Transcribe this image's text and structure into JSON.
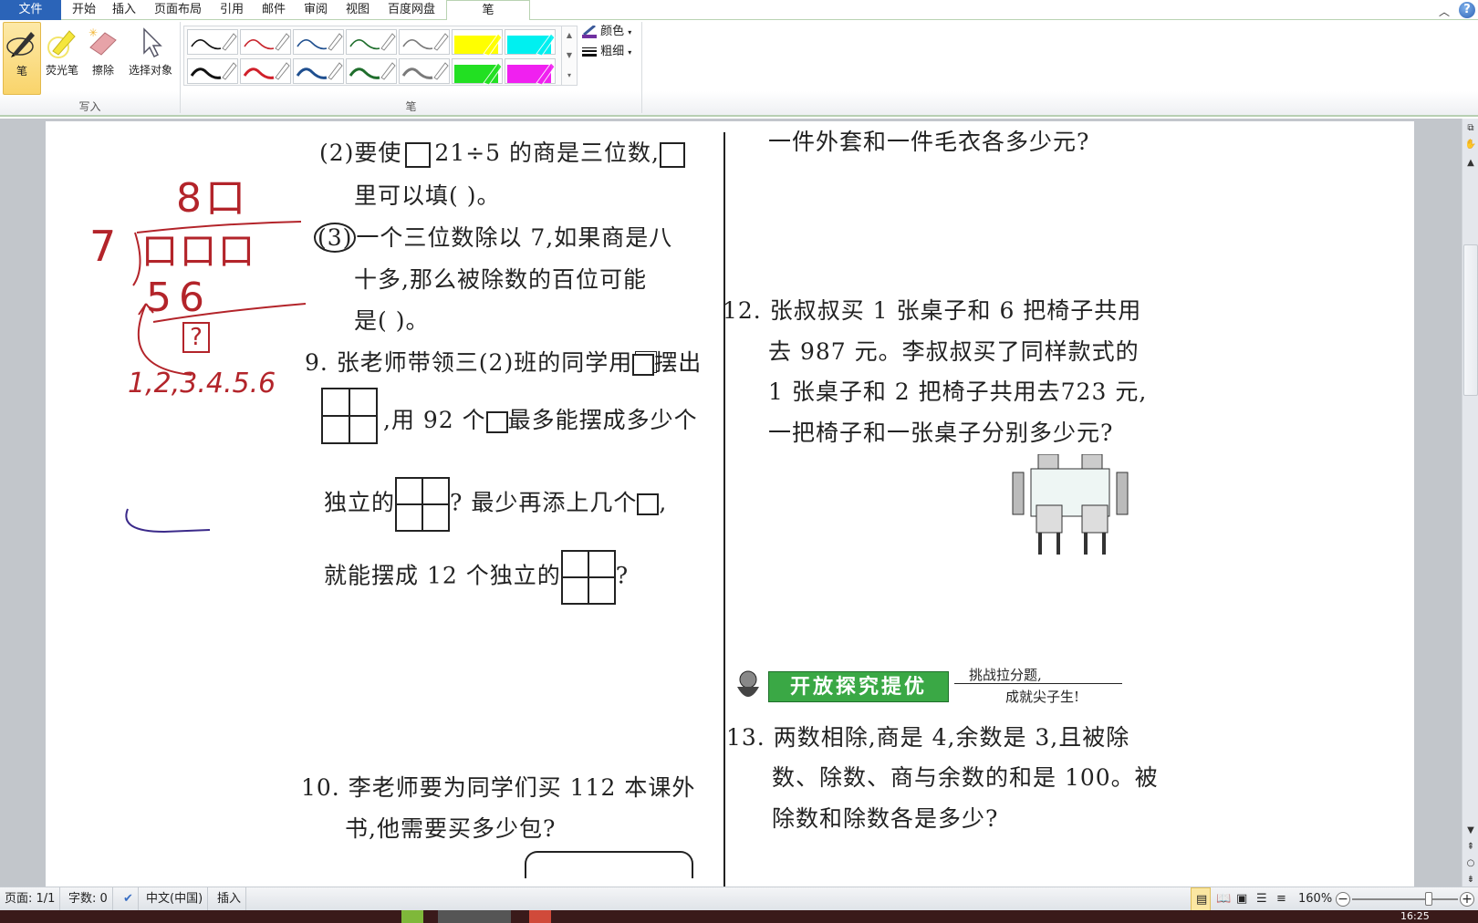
{
  "app": {
    "name": "Word 2010 - Pen tools"
  },
  "tabs": [
    {
      "label": "文件",
      "kind": "file"
    },
    {
      "label": "开始"
    },
    {
      "label": "插入"
    },
    {
      "label": "页面布局"
    },
    {
      "label": "引用"
    },
    {
      "label": "邮件"
    },
    {
      "label": "审阅"
    },
    {
      "label": "视图"
    },
    {
      "label": "百度网盘"
    },
    {
      "label": "笔",
      "active": true
    }
  ],
  "ribbon": {
    "write_group": {
      "label": "写入",
      "buttons": [
        {
          "label": "笔",
          "icon": "pen-icon",
          "selected": true
        },
        {
          "label": "荧光笔",
          "icon": "highlighter-icon"
        },
        {
          "label": "擦除",
          "icon": "eraser-icon"
        },
        {
          "label": "选择对象",
          "icon": "select-cursor-icon"
        }
      ]
    },
    "pen_group": {
      "label": "笔",
      "pens_row1": [
        {
          "color": "#111111",
          "kind": "pen"
        },
        {
          "color": "#c8242c",
          "kind": "pen"
        },
        {
          "color": "#1f4f8f",
          "kind": "pen"
        },
        {
          "color": "#1f6e2c",
          "kind": "pen"
        },
        {
          "color": "#7a7a7a",
          "kind": "pen"
        },
        {
          "color": "#ffff00",
          "kind": "highlighter"
        },
        {
          "color": "#00f0f0",
          "kind": "highlighter"
        }
      ],
      "pens_row2": [
        {
          "color": "#111111",
          "kind": "pen"
        },
        {
          "color": "#d0202a",
          "kind": "pen"
        },
        {
          "color": "#1f4f8f",
          "kind": "pen"
        },
        {
          "color": "#1f6e2c",
          "kind": "pen"
        },
        {
          "color": "#7a7a7a",
          "kind": "pen"
        },
        {
          "color": "#22e022",
          "kind": "highlighter"
        },
        {
          "color": "#f020f0",
          "kind": "highlighter"
        }
      ],
      "color_label": "颜色",
      "weight_label": "粗细"
    }
  },
  "document": {
    "left_column": {
      "q2_line1_a": "(2)要使",
      "q2_line1_b": "21÷5 的商是三位数,",
      "q2_line2": "里可以填(           )。",
      "q3_label": "(3)",
      "q3_line1": "一个三位数除以 7,如果商是八",
      "q3_line2": "十多,那么被除数的百位可能",
      "q3_line3": "是(     )。",
      "q9_line1_a": "9. 张老师带领三(2)班的同学用",
      "q9_line1_b": "摆出",
      "q9_line2_a": ",用 92 个",
      "q9_line2_b": "最多能摆成多少个",
      "q9_line3_a": "独立的",
      "q9_line3_b": "? 最少再添上几个",
      "q9_line3_c": ",",
      "q9_line4_a": "就能摆成 12 个独立的",
      "q9_line4_b": "?",
      "q10_line1": "10. 李老师要为同学们买 112 本课外",
      "q10_line2": "书,他需要买多少包?"
    },
    "right_column": {
      "q11_tail": "一件外套和一件毛衣各多少元?",
      "q12_line1": "12. 张叔叔买 1 张桌子和 6 把椅子共用",
      "q12_line2": "去 987 元。李叔叔买了同样款式的",
      "q12_line3": "1 张桌子和 2 把椅子共用去723 元,",
      "q12_line4": "一把椅子和一张桌子分别多少元?",
      "banner_title": "开放探究提优",
      "banner_slogan1": "挑战拉分题,",
      "banner_slogan2": "成就尖子生!",
      "q13_line1": "13. 两数相除,商是 4,余数是 3,且被除",
      "q13_line2": "数、除数、商与余数的和是 100。被",
      "q13_line3": "除数和除数各是多少?"
    },
    "handwriting": {
      "quotient": "8口",
      "divisor": "7",
      "dividend": "口口口",
      "product": "56",
      "remainder": "?",
      "candidates": "1,2,3.4.5.6"
    }
  },
  "status_bar": {
    "page": "页面: 1/1",
    "words": "字数: 0",
    "language": "中文(中国)",
    "mode": "插入",
    "zoom": "160%",
    "zoom_fraction": 0.72
  },
  "taskbar": {
    "clock": "16:25"
  }
}
